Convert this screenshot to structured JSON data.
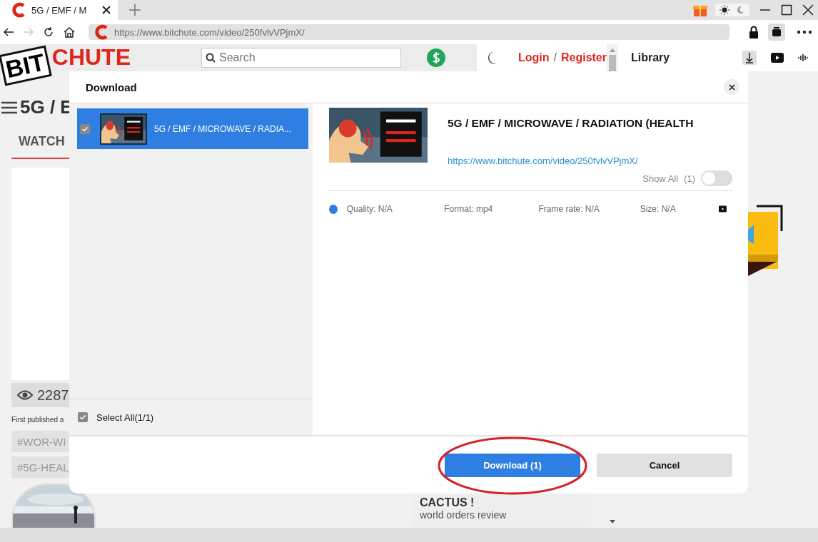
{
  "browser": {
    "tab": {
      "title": "5G / EMF / M"
    },
    "address": "https://www.bitchute.com/video/250fvlvVPjmX/"
  },
  "site": {
    "logo": [
      "BIT",
      "CHUTE"
    ],
    "search": {
      "placeholder": "Search"
    },
    "login": "Login",
    "separator": "/",
    "register": "Register",
    "library": "Library",
    "video_title": "5G / E",
    "tab": "WATCH",
    "views": "2287",
    "published": "First published a",
    "hashtags": [
      "#WOR-WI",
      "#5G-HEAL"
    ],
    "related": {
      "title": "CACTUS !",
      "channel": "world orders review"
    }
  },
  "dialog": {
    "title": "Download",
    "items": [
      {
        "title": "5G / EMF / MICROWAVE / RADIA...",
        "checked": true,
        "selected": true
      }
    ],
    "select_all": {
      "label": "Select All(1/1)",
      "checked": true
    },
    "detail": {
      "title": "5G / EMF / MICROWAVE / RADIATION (HEALTH",
      "url": "https://www.bitchute.com/video/250fvlvVPjmX/",
      "show_all": {
        "label": "Show All",
        "count": "(1)",
        "on": false
      },
      "formats": [
        {
          "selected": true,
          "quality": "Quality: N/A",
          "format": "Format: mp4",
          "frame_rate": "Frame rate: N/A",
          "size": "Size: N/A"
        }
      ]
    },
    "buttons": [
      {
        "label": "Download (1)",
        "kind": "primary",
        "circled": true
      },
      {
        "label": "Cancel",
        "kind": "secondary",
        "circled": false
      }
    ]
  }
}
